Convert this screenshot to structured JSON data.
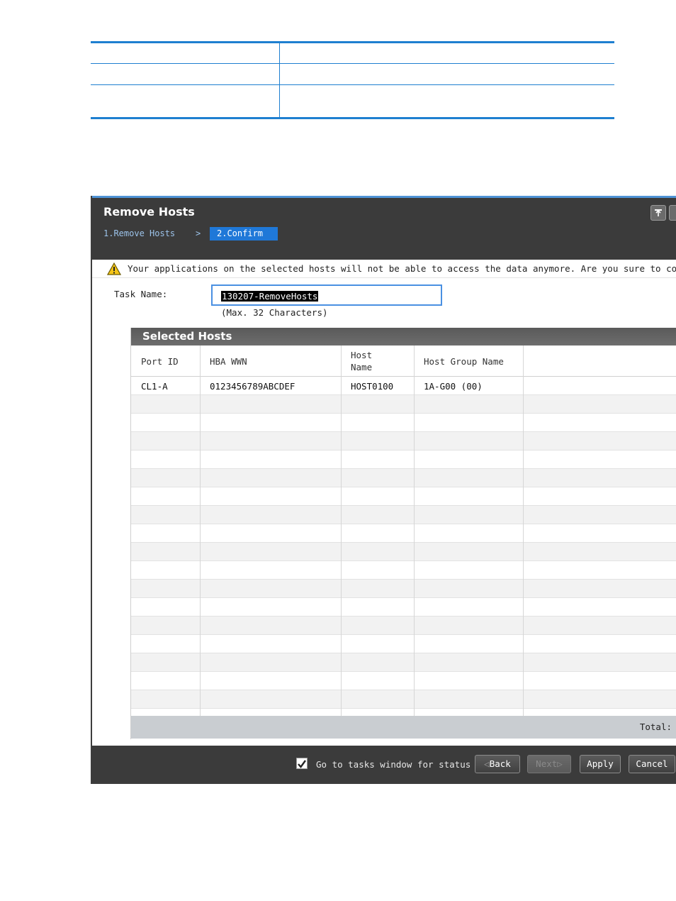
{
  "dialog": {
    "title": "Remove Hosts",
    "steps": [
      {
        "label": "1.Remove Hosts"
      },
      {
        "label": ">"
      },
      {
        "label": "2.Confirm"
      }
    ],
    "warning": "Your applications on the selected hosts will not be able to access the data anymore. Are you sure to continu",
    "task_name_label": "Task Name:",
    "task_name_value": "130207-RemoveHosts",
    "task_name_hint": "(Max. 32 Characters)"
  },
  "selected_hosts": {
    "title": "Selected Hosts",
    "columns": [
      "Port ID",
      "HBA WWN",
      "Host Name",
      "Host Group Name",
      ""
    ],
    "rows": [
      [
        "CL1-A",
        "0123456789ABCDEF",
        "HOST0100",
        "1A-G00 (00)",
        ""
      ]
    ],
    "total_label": "Total:"
  },
  "actions": {
    "go_to_tasks_label": "Go to tasks window for status",
    "go_to_tasks_checked": true,
    "back": "Back",
    "next": "Next",
    "apply": "Apply",
    "cancel": "Cancel"
  },
  "colors": {
    "accent": "#1f78d8",
    "titlebar": "#3b3b3b",
    "table_rule": "#1e7fd0"
  }
}
